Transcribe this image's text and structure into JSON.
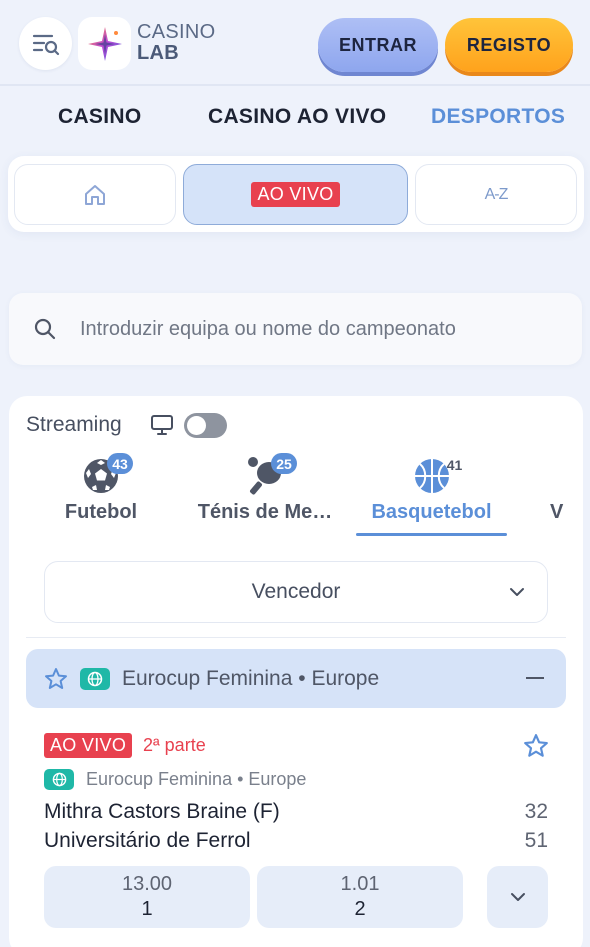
{
  "header": {
    "logo_line1": "CASINO",
    "logo_line2": "LAB",
    "login_label": "ENTRAR",
    "register_label": "REGISTO"
  },
  "nav": {
    "tabs": [
      {
        "label": "CASINO",
        "active": false
      },
      {
        "label": "CASINO AO VIVO",
        "active": false
      },
      {
        "label": "DESPORTOS",
        "active": true
      }
    ]
  },
  "subtabs": {
    "home_icon": "home-icon",
    "live_label": "AO VIVO",
    "az_label": "A-Z"
  },
  "search": {
    "placeholder": "Introduzir equipa ou nome do campeonato",
    "value": ""
  },
  "streaming": {
    "label": "Streaming",
    "enabled": false
  },
  "sports": [
    {
      "label": "Futebol",
      "count": "43",
      "icon": "soccer-ball-icon",
      "active": false
    },
    {
      "label": "Ténis de Me…",
      "count": "25",
      "icon": "table-tennis-icon",
      "active": false
    },
    {
      "label": "Basquetebol",
      "count": "41",
      "icon": "basketball-icon",
      "active": true
    },
    {
      "label": "V",
      "count": "",
      "icon": "",
      "active": false
    }
  ],
  "market_select": {
    "value": "Vencedor"
  },
  "league": {
    "name": "Eurocup Feminina • Europe"
  },
  "match": {
    "live_label": "AO VIVO",
    "period": "2ª parte",
    "league": "Eurocup Feminina • Europe",
    "home_team": "Mithra Castors Braine (F)",
    "away_team": "Universitário de Ferrol",
    "home_score": "32",
    "away_score": "51",
    "odds": [
      {
        "price": "13.00",
        "selection": "1"
      },
      {
        "price": "1.01",
        "selection": "2"
      }
    ]
  },
  "colors": {
    "accent": "#5b8fd8",
    "live_red": "#e8414f",
    "register_yellow": "#ffb22a",
    "login_blue": "#9fb3f2"
  }
}
